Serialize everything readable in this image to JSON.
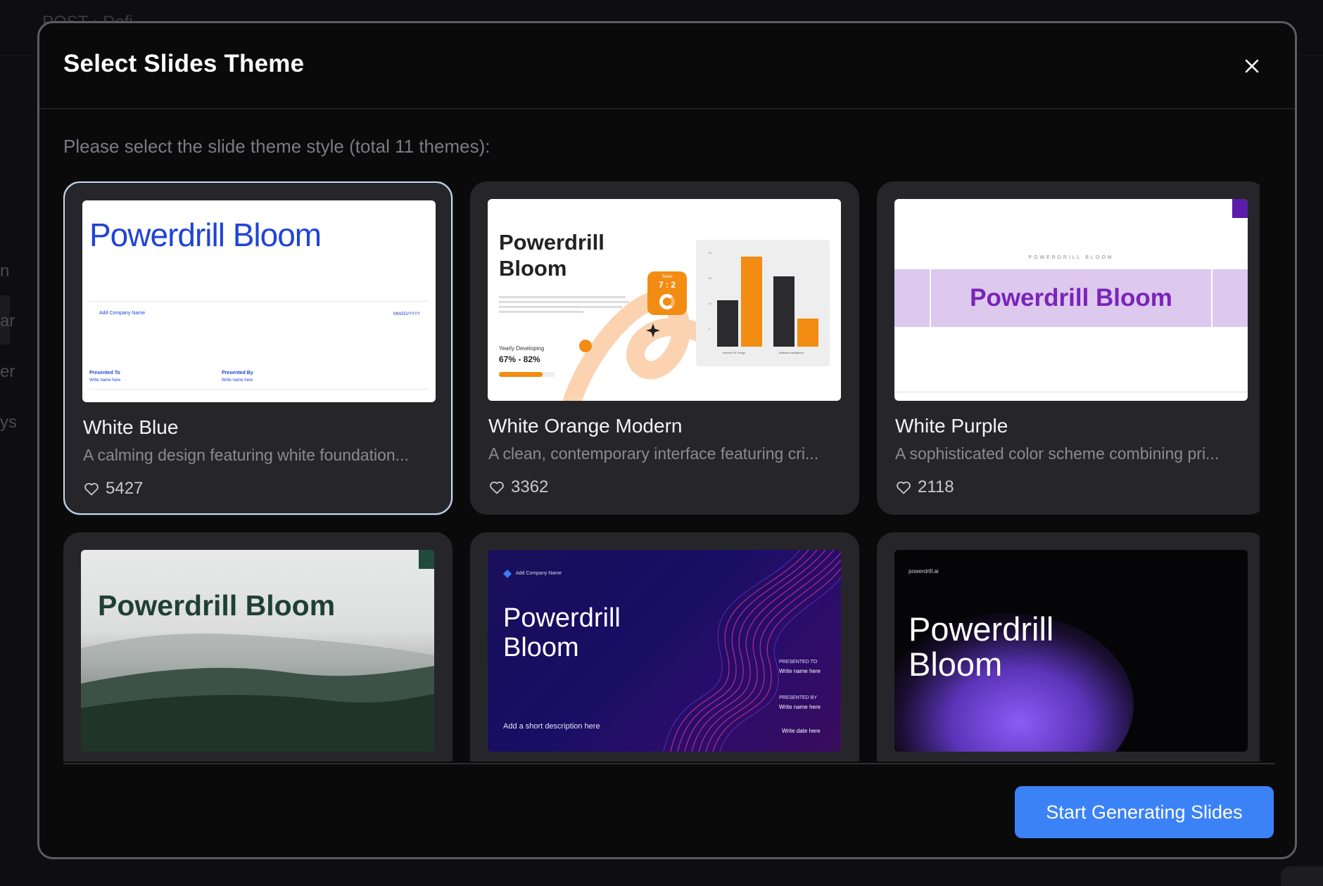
{
  "background": {
    "breadcrumb": "POST  ›  Dofi...",
    "side_letters": [
      "n",
      "ar",
      "er",
      "ys"
    ]
  },
  "modal": {
    "title": "Select Slides Theme",
    "close_icon": "close-icon",
    "subtitle": "Please select the slide theme style (total 11 themes):",
    "primary_button": "Start Generating Slides"
  },
  "themes": [
    {
      "name": "White Blue",
      "description": "A calming design featuring white foundation...",
      "likes": "5427",
      "selected": true,
      "preview": {
        "title": "Powerdrill Bloom",
        "company": "Add Company Name",
        "date": "MM/DD/YYYY",
        "presented_to_label": "Presented To",
        "presented_to_value": "Write name here",
        "presented_by_label": "Presented By",
        "presented_by_value": "Write name here"
      }
    },
    {
      "name": "White Orange Modern",
      "description": "A clean, contemporary interface featuring cri...",
      "likes": "3362",
      "selected": false,
      "preview": {
        "title_line1": "Powerdrill",
        "title_line2": "Bloom",
        "badge_top": "Tasks",
        "badge_ratio": "7 : 2",
        "yearly_label": "Yearly Developing",
        "yearly_range": "67% - 82%",
        "yearly_progress": 0.78,
        "chart_categories": [
          "Internet Of Things",
          "Artificial Intelligence"
        ],
        "chart_axis": [
          "80",
          "60",
          "40",
          "0"
        ]
      }
    },
    {
      "name": "White Purple",
      "description": "A sophisticated color scheme combining pri...",
      "likes": "2118",
      "selected": false,
      "preview": {
        "kicker": "POWERDRILL BLOOM",
        "title": "Powerdrill Bloom"
      }
    },
    {
      "name": "",
      "description": "",
      "likes": "",
      "selected": false,
      "preview": {
        "title": "Powerdrill Bloom"
      }
    },
    {
      "name": "",
      "description": "",
      "likes": "",
      "selected": false,
      "preview": {
        "company": "Add Company Name",
        "title_line1": "Powerdrill",
        "title_line2": "Bloom",
        "presented_to_label": "PRESENTED TO",
        "presented_to_value": "Write name here",
        "presented_by_label": "PRESENTED BY",
        "presented_by_value": "Write name here",
        "description": "Add a short description here",
        "date": "Write date here"
      }
    },
    {
      "name": "",
      "description": "",
      "likes": "",
      "selected": false,
      "preview": {
        "site": "powerdrill.ai",
        "title_line1": "Powerdrill",
        "title_line2": "Bloom"
      }
    }
  ],
  "colors": {
    "primary": "#3b82f6",
    "selected_border": "#c8d9f3",
    "card_bg": "#26262a",
    "modal_bg": "#0a0a0b"
  }
}
